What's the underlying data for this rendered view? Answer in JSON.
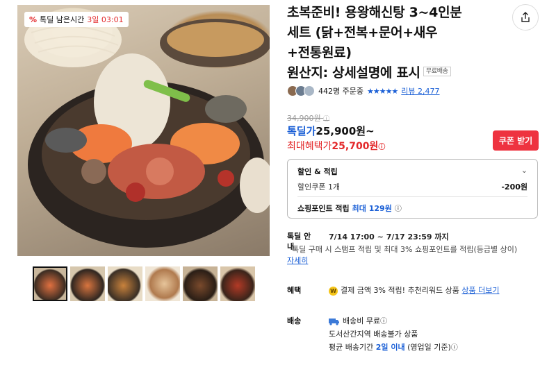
{
  "gallery": {
    "timer": {
      "label": "톡딜 남은시간",
      "time": "3일 03:01"
    },
    "thumbnails": [
      "1",
      "2",
      "3",
      "4",
      "5",
      "6"
    ]
  },
  "product": {
    "title_line1": "초복준비! 용왕해신탕 3~4인분",
    "title_line2": "세트 (닭+전복+문어+새우",
    "title_line3": "+전통원료)",
    "title_line4": "원산지: 상세설명에 표시",
    "free_shipping_badge": "무료배송",
    "orders": "442명 주문중",
    "stars": "★★★★★",
    "review_link": "리뷰 2,477",
    "original_price": "34,900원",
    "deal_label": "톡딜가",
    "deal_price": "25,900원~",
    "max_benefit_label": "최대혜택가",
    "max_benefit_price": "25,700원",
    "coupon_button": "쿠폰 받기"
  },
  "benefit_box": {
    "header": "할인 & 적립",
    "coupon_label": "할인쿠폰 1개",
    "coupon_value": "-200원",
    "point_label": "쇼핑포인트 적립",
    "point_value": "최대 129원"
  },
  "talkdeal": {
    "label": "톡딜 안내",
    "period": "7/14 17:00 ~ 7/17 23:59 까지",
    "desc": "톡딜 구매 시 스탬프 적립 및 최대 3% 쇼핑포인트를 적립(등급별 상이)",
    "detail_link": "자세히"
  },
  "benefit": {
    "label": "혜택",
    "text": "결제 금액 3% 적립! 추천리워드 상품",
    "link": "상품 더보기"
  },
  "shipping": {
    "label": "배송",
    "fee": "배송비 무료",
    "note": "도서산간지역 배송불가 상품",
    "avg_prefix": "평균 배송기간",
    "avg_days": "2일 이내",
    "avg_suffix": "(영업일 기준)"
  }
}
